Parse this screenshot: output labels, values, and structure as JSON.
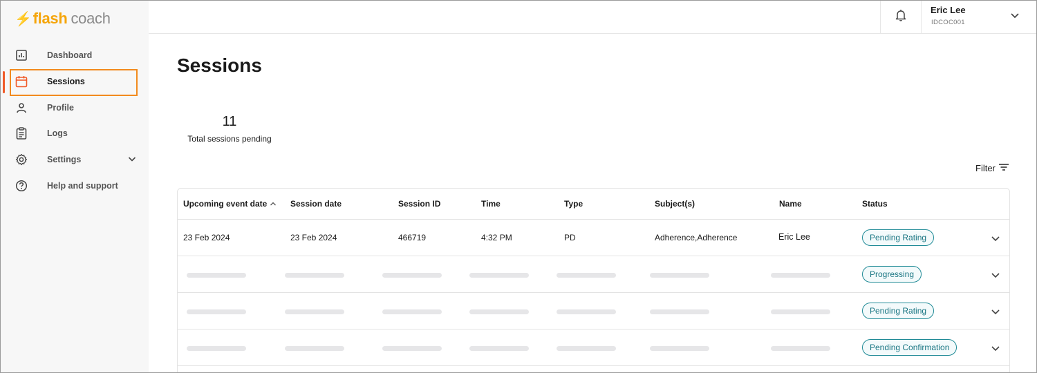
{
  "brand": {
    "bolt": "⚡",
    "flash": "flash",
    "coach": "coach"
  },
  "sidebar": {
    "items": [
      {
        "label": "Dashboard",
        "icon": "bar-chart-icon"
      },
      {
        "label": "Sessions",
        "icon": "calendar-icon",
        "active": true
      },
      {
        "label": "Profile",
        "icon": "person-icon"
      },
      {
        "label": "Logs",
        "icon": "clipboard-icon"
      },
      {
        "label": "Settings",
        "icon": "gear-icon",
        "expandable": true
      },
      {
        "label": "Help and support",
        "icon": "help-circle-icon"
      }
    ]
  },
  "header": {
    "user_name": "Eric Lee",
    "user_id": "IDCOC001"
  },
  "main": {
    "title": "Sessions",
    "stat": {
      "value": "11",
      "label": "Total sessions pending"
    },
    "filter_label": "Filter"
  },
  "table": {
    "columns": [
      "Upcoming event date",
      "Session date",
      "Session ID",
      "Time",
      "Type",
      "Subject(s)",
      "Name",
      "Status"
    ],
    "rows": [
      {
        "upcoming": "23 Feb 2024",
        "session_date": "23 Feb 2024",
        "session_id": "466719",
        "time": "4:32 PM",
        "type": "PD",
        "subjects": "Adherence,Adherence",
        "name": "Eric Lee",
        "status": "Pending Rating"
      },
      {
        "status": "Progressing"
      },
      {
        "status": "Pending Rating"
      },
      {
        "status": "Pending Confirmation"
      }
    ]
  },
  "colors": {
    "brand_orange": "#f5a50a",
    "active_indicator": "#f05a28",
    "highlight_box": "#f28a1e",
    "badge_teal": "#1f8a96"
  }
}
